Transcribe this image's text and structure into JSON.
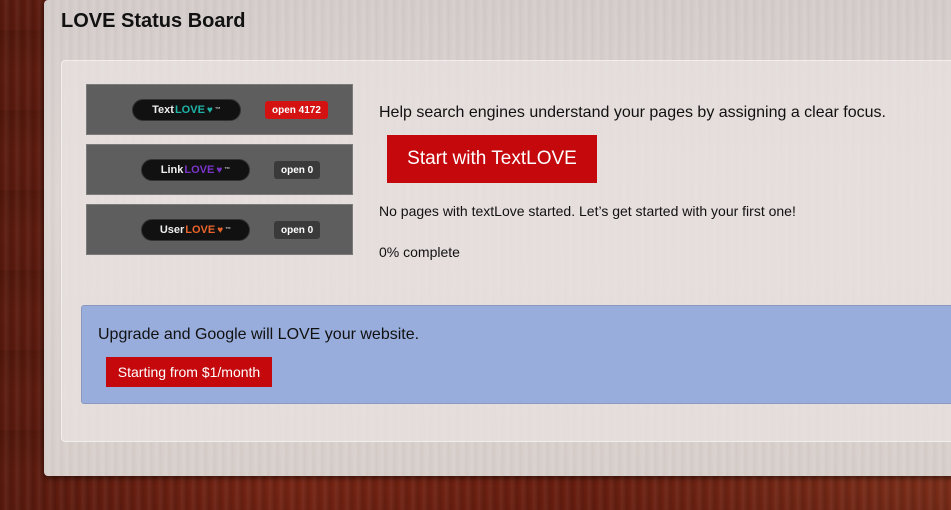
{
  "header": {
    "title": "LOVE Status Board"
  },
  "badges": [
    {
      "prefix": "Text",
      "love": "LOVE",
      "love_color": "#1fb3a6",
      "heart": "♥",
      "heart_color": "#1fb3a6",
      "tm": "™",
      "open_label": "open 4172",
      "open_color": "#d41212"
    },
    {
      "prefix": "Link",
      "love": "LOVE",
      "love_color": "#7a35c8",
      "heart": "♥",
      "heart_color": "#7a35c8",
      "tm": "™",
      "open_label": "open 0",
      "open_color": "#3a3a3a"
    },
    {
      "prefix": "User",
      "love": "LOVE",
      "love_color": "#e8642a",
      "heart": "♥",
      "heart_color": "#e8642a",
      "tm": "™",
      "open_label": "open 0",
      "open_color": "#3a3a3a"
    }
  ],
  "main": {
    "help_text": "Help search engines understand your pages by assigning a clear focus.",
    "start_button": "Start with TextLOVE",
    "status_text": "No pages with textLove started. Let’s get started with your first one!",
    "progress_text": "0% complete"
  },
  "upgrade": {
    "text": "Upgrade and Google will LOVE your website.",
    "button": "Starting from $1/month"
  },
  "colors": {
    "accent": "#c4080c",
    "upgrade_bg": "#8ca5dc"
  }
}
